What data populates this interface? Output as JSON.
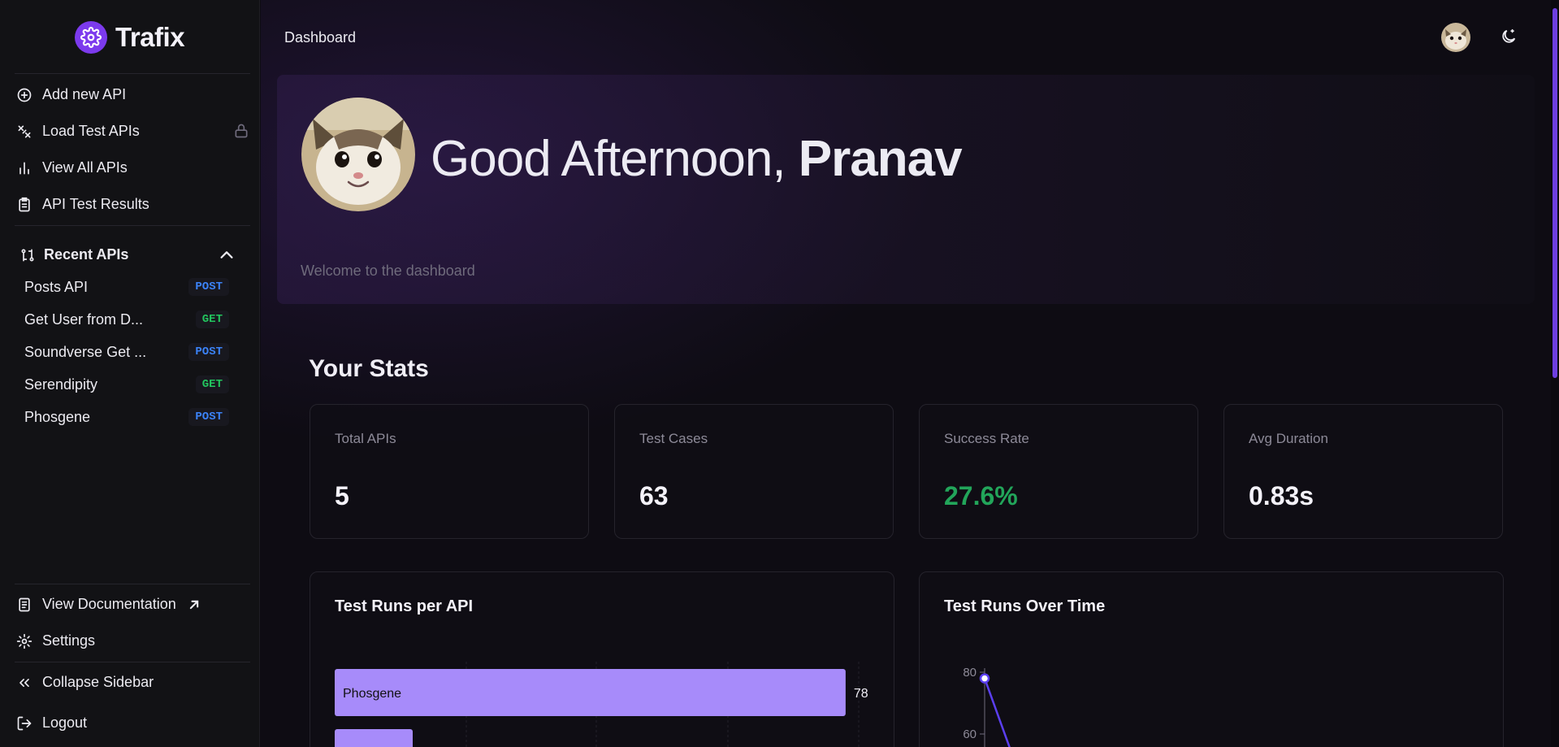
{
  "brand": {
    "name": "Trafix"
  },
  "nav": [
    {
      "label": "Add new API",
      "icon": "plus-circle-icon"
    },
    {
      "label": "Load Test APIs",
      "icon": "load-test-icon",
      "locked": true
    },
    {
      "label": "View All APIs",
      "icon": "bar-chart-icon"
    },
    {
      "label": "API Test Results",
      "icon": "clipboard-icon"
    }
  ],
  "recent": {
    "title": "Recent APIs",
    "items": [
      {
        "label": "Posts API",
        "method": "POST"
      },
      {
        "label": "Get User from D...",
        "method": "GET"
      },
      {
        "label": "Soundverse Get ...",
        "method": "POST"
      },
      {
        "label": "Serendipity",
        "method": "GET"
      },
      {
        "label": "Phosgene",
        "method": "POST"
      }
    ]
  },
  "footer_nav": {
    "docs": "View Documentation",
    "settings": "Settings",
    "collapse": "Collapse Sidebar",
    "logout": "Logout"
  },
  "header": {
    "breadcrumb": "Dashboard"
  },
  "hero": {
    "greeting": "Good Afternoon, ",
    "name": "Pranav",
    "subtitle": "Welcome to the dashboard"
  },
  "stats": {
    "title": "Your Stats",
    "cards": [
      {
        "label": "Total APIs",
        "value": "5"
      },
      {
        "label": "Test Cases",
        "value": "63"
      },
      {
        "label": "Success Rate",
        "value": "27.6%",
        "color": "#22a55a"
      },
      {
        "label": "Avg Duration",
        "value": "0.83s"
      }
    ]
  },
  "panels": {
    "runs_per_api": "Test Runs per API",
    "runs_over_time": "Test Runs Over Time"
  },
  "chart_data": [
    {
      "type": "bar",
      "title": "Test Runs per API",
      "categories": [
        "Phosgene"
      ],
      "values": [
        78
      ],
      "xlim": [
        0,
        80
      ],
      "colors": {
        "bar": "#a78bfa"
      }
    },
    {
      "type": "line",
      "title": "Test Runs Over Time",
      "y_ticks": [
        80,
        60
      ],
      "values": [
        78
      ],
      "colors": {
        "line": "#5b3ff0"
      }
    }
  ]
}
